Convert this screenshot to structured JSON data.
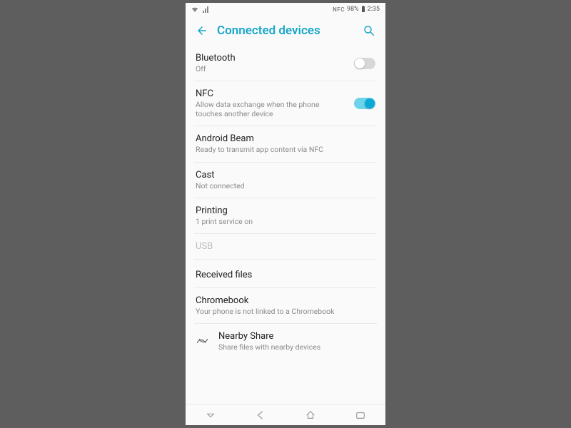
{
  "status": {
    "nfc_label": "NFC",
    "battery_pct": "98%",
    "clock": "2:35"
  },
  "header": {
    "title": "Connected devices"
  },
  "rows": {
    "bluetooth": {
      "title": "Bluetooth",
      "sub": "Off",
      "on": false
    },
    "nfc": {
      "title": "NFC",
      "sub": "Allow data exchange when the phone touches another device",
      "on": true
    },
    "beam": {
      "title": "Android Beam",
      "sub": "Ready to transmit app content via NFC"
    },
    "cast": {
      "title": "Cast",
      "sub": "Not connected"
    },
    "printing": {
      "title": "Printing",
      "sub": "1 print service on"
    },
    "usb": {
      "title": "USB"
    },
    "received": {
      "title": "Received files"
    },
    "chromebook": {
      "title": "Chromebook",
      "sub": "Your phone is not linked to a Chromebook"
    },
    "nearby": {
      "title": "Nearby Share",
      "sub": "Share files with nearby devices"
    }
  }
}
